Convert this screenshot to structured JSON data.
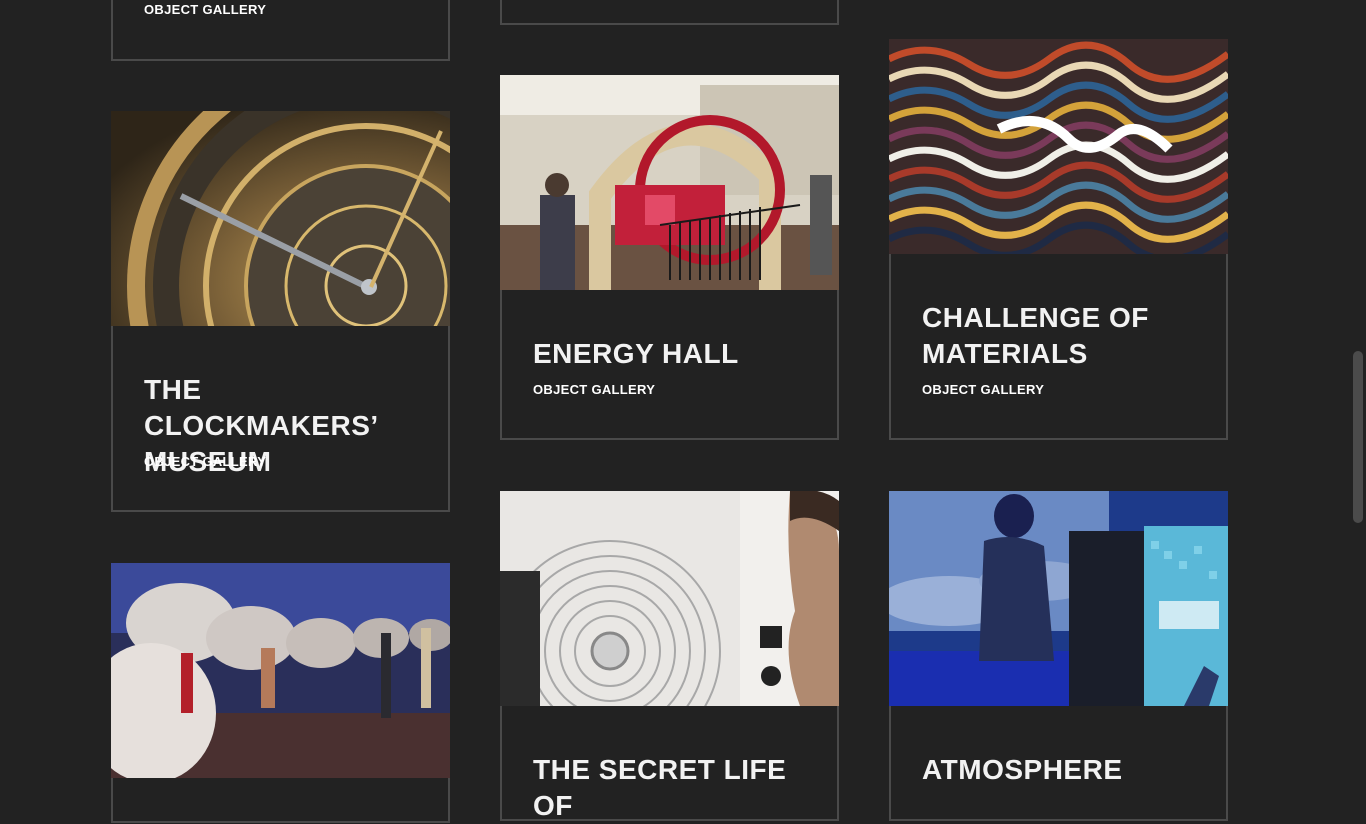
{
  "cards": [
    {
      "title": "",
      "subtitle": "OBJECT GALLERY"
    },
    {
      "title": "",
      "subtitle": ""
    },
    {
      "title": "THE CLOCKMAKERS’ MUSEUM",
      "subtitle": "OBJECT GALLERY",
      "image": "clock-astrolabe-image"
    },
    {
      "title": "ENERGY HALL",
      "subtitle": "OBJECT GALLERY",
      "image": "steam-engine-hall-image"
    },
    {
      "title": "CHALLENGE OF MATERIALS",
      "subtitle": "OBJECT GALLERY",
      "image": "marbled-pattern-image"
    },
    {
      "title": "",
      "subtitle": "",
      "image": "pod-exhibition-image"
    },
    {
      "title": "THE SECRET LIFE OF",
      "subtitle": "",
      "image": "cd-player-exhibit-image"
    },
    {
      "title": "ATMOSPHERE",
      "subtitle": "",
      "image": "blue-interactive-screen-image"
    }
  ],
  "colors": {
    "background": "#222222",
    "border": "#4a4a4a",
    "text": "#f2f2f2"
  }
}
